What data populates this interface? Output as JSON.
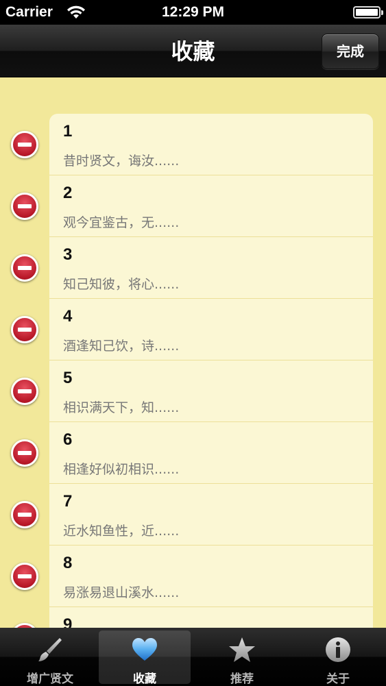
{
  "status_bar": {
    "carrier": "Carrier",
    "time": "12:29 PM",
    "wifi_icon": "wifi-icon",
    "battery_icon": "battery-icon"
  },
  "navbar": {
    "title": "收藏",
    "done_label": "完成"
  },
  "favorites": [
    {
      "number": "1",
      "preview": "昔时贤文，诲汝......"
    },
    {
      "number": "2",
      "preview": "观今宜鉴古，无......"
    },
    {
      "number": "3",
      "preview": "知己知彼，将心......"
    },
    {
      "number": "4",
      "preview": "酒逢知己饮，诗......"
    },
    {
      "number": "5",
      "preview": "相识满天下，知......"
    },
    {
      "number": "6",
      "preview": "相逢好似初相识......"
    },
    {
      "number": "7",
      "preview": "近水知鱼性，近......"
    },
    {
      "number": "8",
      "preview": "易涨易退山溪水......"
    },
    {
      "number": "9",
      "preview": ""
    }
  ],
  "tabbar": {
    "tabs": [
      {
        "label": "增广贤文",
        "icon": "brush-icon",
        "active": false
      },
      {
        "label": "收藏",
        "icon": "heart-icon",
        "active": true
      },
      {
        "label": "推荐",
        "icon": "star-icon",
        "active": false
      },
      {
        "label": "关于",
        "icon": "info-icon",
        "active": false
      }
    ]
  },
  "colors": {
    "list_background": "#f2e89a",
    "row_background": "#fbf7d4",
    "delete_red": "#c01f2e",
    "active_heart": "#4aa3e8"
  }
}
